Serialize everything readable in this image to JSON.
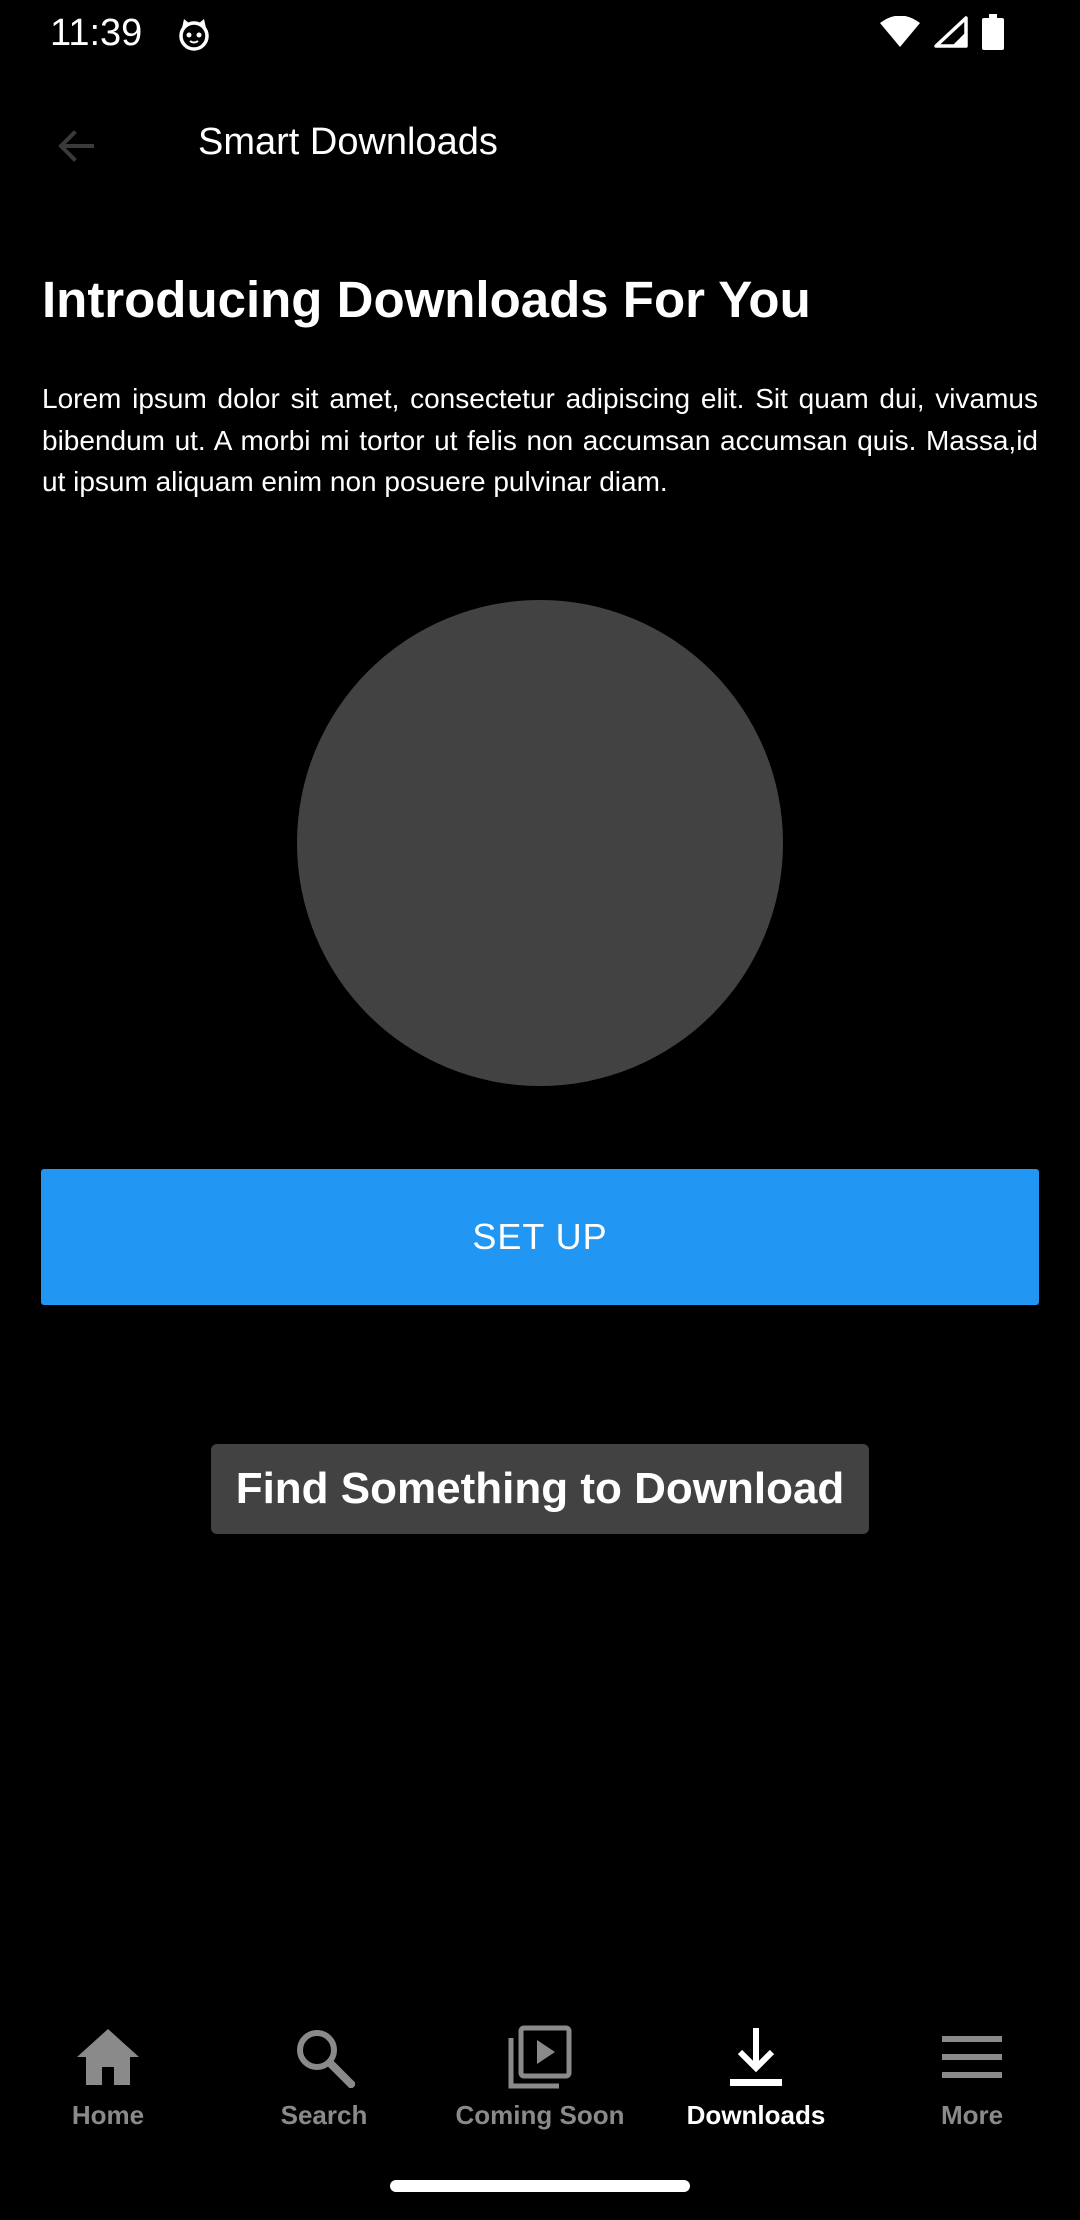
{
  "status_bar": {
    "time": "11:39",
    "icons": [
      "cat-icon",
      "wifi-icon",
      "signal-icon",
      "battery-icon"
    ]
  },
  "app_bar": {
    "title": "Smart Downloads",
    "back_icon": "arrow-left-icon"
  },
  "main": {
    "headline": "Introducing Downloads For You",
    "body": "Lorem ipsum dolor sit amet, consectetur adipiscing elit. Sit quam dui, vivamus bibendum ut. A morbi mi tortor ut felis non accumsan accumsan quis. Massa,id ut ipsum aliquam enim non posuere pulvinar diam.",
    "setup_label": "SET UP",
    "find_label": "Find Something to Download"
  },
  "bottom_nav": {
    "items": [
      {
        "label": "Home",
        "icon": "home-icon",
        "active": false
      },
      {
        "label": "Search",
        "icon": "search-icon",
        "active": false
      },
      {
        "label": "Coming Soon",
        "icon": "video-library-icon",
        "active": false
      },
      {
        "label": "Downloads",
        "icon": "download-icon",
        "active": true
      },
      {
        "label": "More",
        "icon": "menu-icon",
        "active": false
      }
    ]
  },
  "colors": {
    "background": "#000000",
    "accent": "#2196F3",
    "placeholder": "#424242",
    "inactive": "#8A8A8A"
  }
}
